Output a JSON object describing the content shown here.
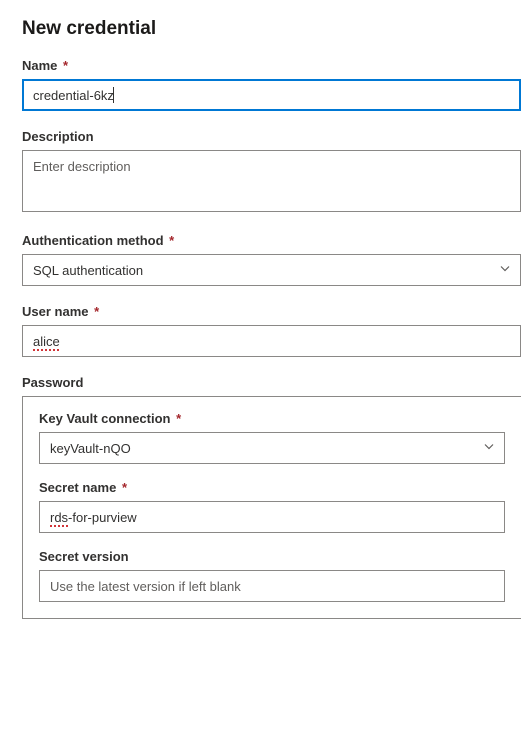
{
  "title": "New credential",
  "labels": {
    "name": "Name",
    "description": "Description",
    "auth_method": "Authentication method",
    "user_name": "User name",
    "password": "Password",
    "key_vault": "Key Vault connection",
    "secret_name": "Secret name",
    "secret_version": "Secret version"
  },
  "required_mark": "*",
  "values": {
    "name": "credential-6kz",
    "description": "",
    "auth_method": "SQL authentication",
    "user_name": "alice",
    "key_vault": "keyVault-nQO",
    "secret_name": "rds-for-purview",
    "secret_version": ""
  },
  "placeholders": {
    "description": "Enter description",
    "secret_version": "Use the latest version if left blank"
  }
}
